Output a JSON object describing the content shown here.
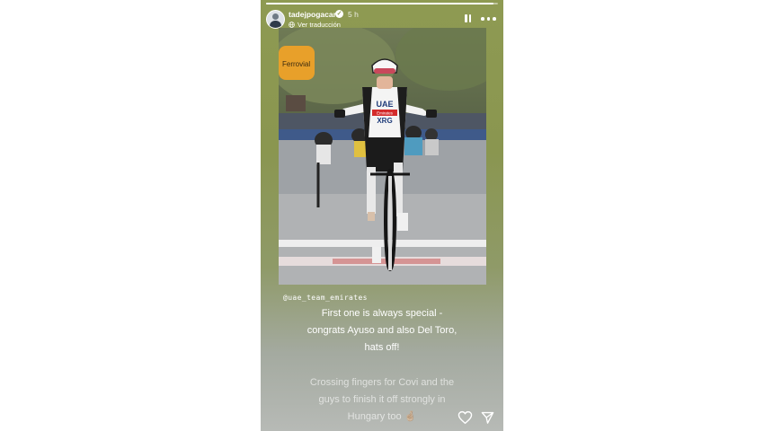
{
  "story": {
    "username": "tadejpogacar",
    "time_ago": "5 h",
    "translate_label": "Ver traducción",
    "progress_fraction": 0.98,
    "mention": "@uae_team_emirates",
    "caption_lines": [
      "First one is always special -",
      "congrats Ayuso and also Del Toro,",
      "hats off!"
    ],
    "caption2_lines": [
      "Crossing fingers for Covi and the",
      "guys to finish it off strongly in",
      "Hungary too 🤞🏼"
    ],
    "photo": {
      "jersey_lines": [
        "UAE",
        "Emirates",
        "XRG"
      ],
      "sign_text": "Ferrovial",
      "icons": {
        "avatar": "profile-avatar",
        "verified": "verified-badge-icon",
        "translate": "globe-icon",
        "pause": "pause-icon",
        "more": "more-options-icon",
        "like": "heart-icon",
        "share": "send-icon"
      }
    }
  },
  "colors": {
    "story_background_top": "#8e9a52",
    "story_background_bottom": "#b7bab6",
    "caption_text": "#ffffff"
  }
}
